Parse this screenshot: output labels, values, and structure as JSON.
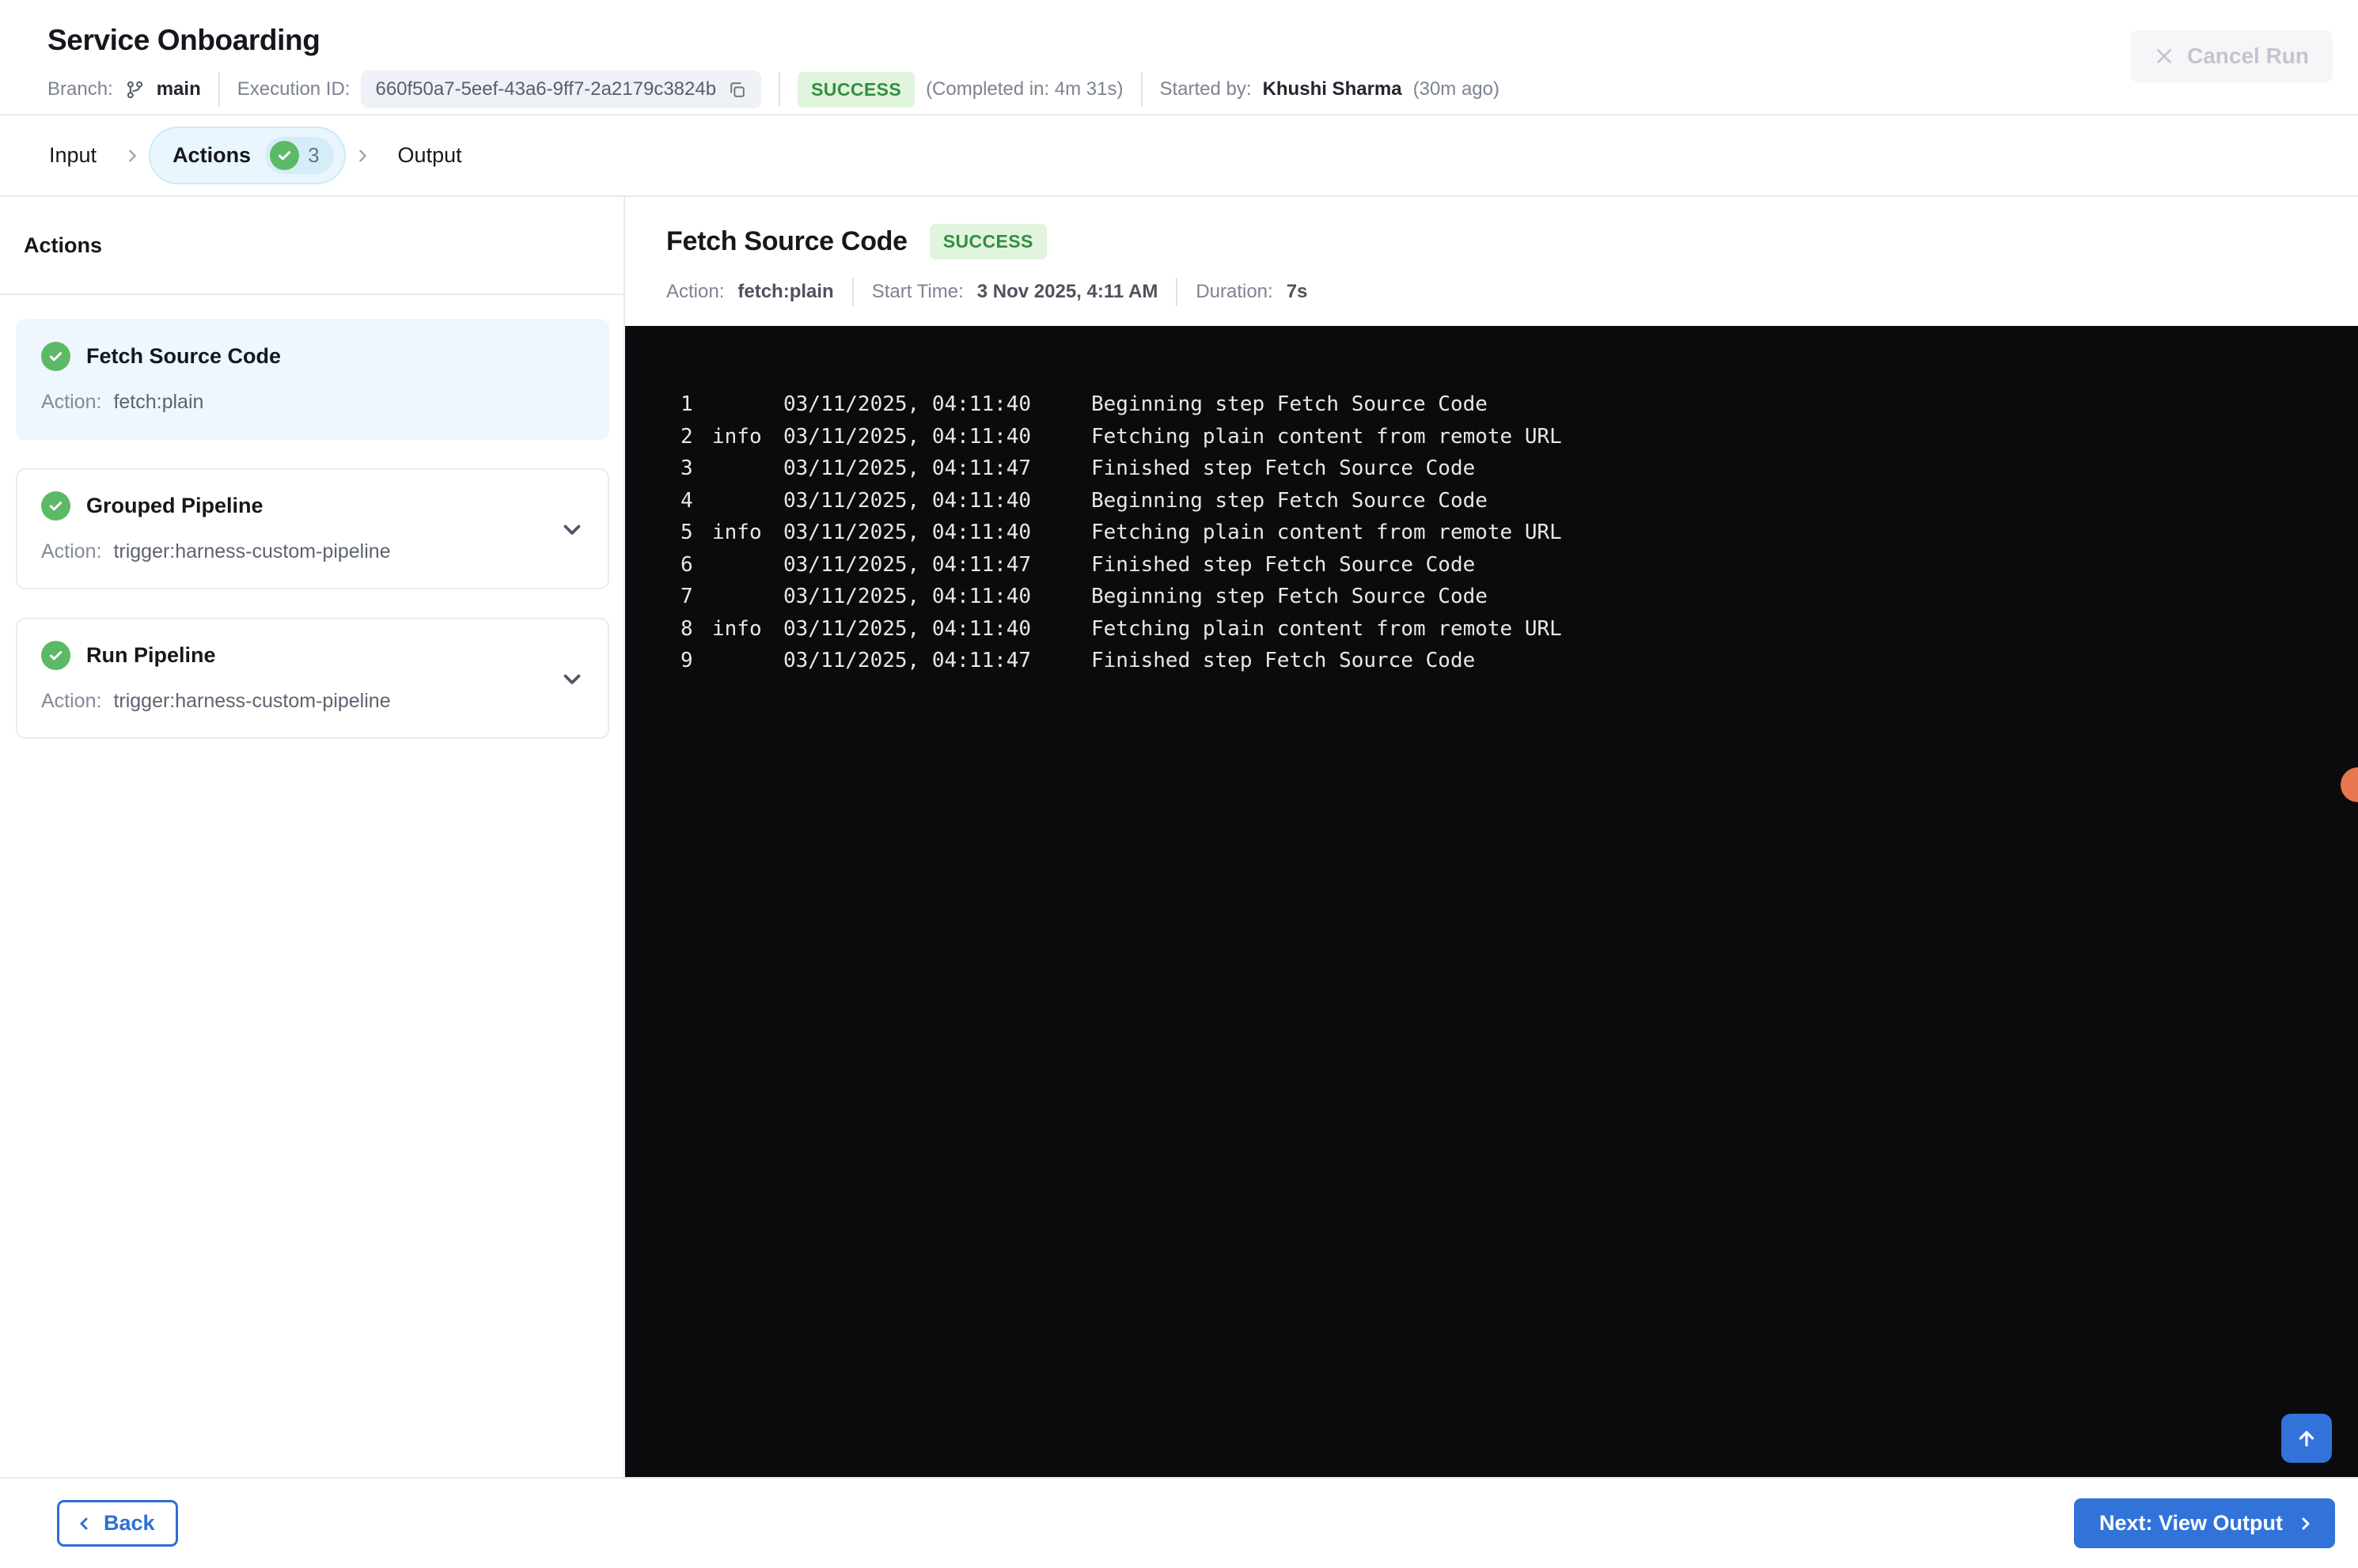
{
  "header": {
    "title": "Service Onboarding",
    "branch_label": "Branch:",
    "branch_value": "main",
    "execution_id_label": "Execution ID:",
    "execution_id": "660f50a7-5eef-43a6-9ff7-2a2179c3824b",
    "status": "SUCCESS",
    "completed_in": "(Completed in: 4m 31s)",
    "started_by_label": "Started by:",
    "started_by": "Khushi Sharma",
    "started_ago": "(30m ago)",
    "cancel_run_label": "Cancel Run"
  },
  "tabs": {
    "items": [
      {
        "label": "Input",
        "active": false
      },
      {
        "label": "Actions",
        "active": true,
        "badge_count": "3"
      },
      {
        "label": "Output",
        "active": false
      }
    ]
  },
  "sidebar": {
    "heading": "Actions",
    "action_label": "Action:",
    "items": [
      {
        "title": "Fetch Source Code",
        "action": "fetch:plain",
        "status": "success",
        "selected": true,
        "expandable": false
      },
      {
        "title": "Grouped Pipeline",
        "action": "trigger:harness-custom-pipeline",
        "status": "success",
        "selected": false,
        "expandable": true
      },
      {
        "title": "Run Pipeline",
        "action": "trigger:harness-custom-pipeline",
        "status": "success",
        "selected": false,
        "expandable": true
      }
    ]
  },
  "detail": {
    "title": "Fetch Source Code",
    "status": "SUCCESS",
    "action_label": "Action:",
    "action_value": "fetch:plain",
    "start_time_label": "Start Time:",
    "start_time_value": "3 Nov 2025, 4:11 AM",
    "duration_label": "Duration:",
    "duration_value": "7s"
  },
  "console": {
    "lines": [
      {
        "num": "1",
        "level": "",
        "time": "03/11/2025, 04:11:40",
        "message": "Beginning step Fetch Source Code"
      },
      {
        "num": "2",
        "level": "info",
        "time": "03/11/2025, 04:11:40",
        "message": "Fetching plain content from remote URL"
      },
      {
        "num": "3",
        "level": "",
        "time": "03/11/2025, 04:11:47",
        "message": "Finished step Fetch Source Code"
      },
      {
        "num": "4",
        "level": "",
        "time": "03/11/2025, 04:11:40",
        "message": "Beginning step Fetch Source Code"
      },
      {
        "num": "5",
        "level": "info",
        "time": "03/11/2025, 04:11:40",
        "message": "Fetching plain content from remote URL"
      },
      {
        "num": "6",
        "level": "",
        "time": "03/11/2025, 04:11:47",
        "message": "Finished step Fetch Source Code"
      },
      {
        "num": "7",
        "level": "",
        "time": "03/11/2025, 04:11:40",
        "message": "Beginning step Fetch Source Code"
      },
      {
        "num": "8",
        "level": "info",
        "time": "03/11/2025, 04:11:40",
        "message": "Fetching plain content from remote URL"
      },
      {
        "num": "9",
        "level": "",
        "time": "03/11/2025, 04:11:47",
        "message": "Finished step Fetch Source Code"
      }
    ]
  },
  "footer": {
    "back_label": "Back",
    "next_label": "Next: View Output"
  },
  "colors": {
    "primary_blue": "#3273d9",
    "success_green": "#5cb966",
    "success_badge_bg": "#e1f4dd",
    "success_badge_text": "#318f40",
    "active_tab_bg": "#e9f6fd",
    "active_tab_border": "#cdeaf7",
    "selected_card_bg": "#edf7fd",
    "console_bg": "#0b0b0d",
    "marker_orange": "#e8764f",
    "disabled_text": "#c2c5d0"
  }
}
